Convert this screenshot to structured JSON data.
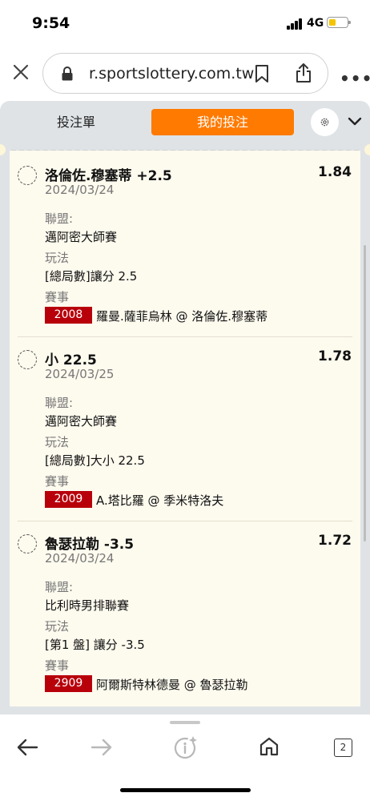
{
  "status_bar": {
    "time": "9:54",
    "network": "4G"
  },
  "browser": {
    "url": "r.sportslottery.com.tw",
    "tab_count": "2"
  },
  "slip": {
    "tabs": [
      {
        "label": "投注單"
      },
      {
        "label": "我的投注"
      }
    ],
    "active_tab": "我的投注",
    "labels": {
      "league": "聯盟:",
      "market": "玩法",
      "event": "賽事"
    },
    "bets": [
      {
        "selection": "洛倫佐.穆塞蒂 +2.5",
        "odds": "1.84",
        "date": "2024/03/24",
        "league": "邁阿密大師賽",
        "market": "[總局數]讓分 2.5",
        "code": "2008",
        "match": "羅曼.薩菲烏林 @ 洛倫佐.穆塞蒂"
      },
      {
        "selection": "小 22.5",
        "odds": "1.78",
        "date": "2024/03/25",
        "league": "邁阿密大師賽",
        "market": "[總局數]大小 22.5",
        "code": "2009",
        "match": "A.塔比羅 @ 季米特洛夫"
      },
      {
        "selection": "魯瑟拉勒 -3.5",
        "odds": "1.72",
        "date": "2024/03/24",
        "league": "比利時男排聯賽",
        "market": "[第1 盤] 讓分 -3.5",
        "code": "2909",
        "match": "阿爾斯特林德曼 @ 魯瑟拉勒"
      }
    ]
  },
  "colors": {
    "accent_orange": "#ff7a00",
    "event_code_red": "#b8000b",
    "ticket_bg": "#fdfaee",
    "panel_gray": "#dfe3e6"
  },
  "icons": [
    "close-icon",
    "lock-icon",
    "bookmark-icon",
    "share-icon",
    "more-icon",
    "gear-icon",
    "chevron-down-icon",
    "back-icon",
    "forward-icon",
    "info-icon",
    "home-icon",
    "tabs-icon"
  ]
}
